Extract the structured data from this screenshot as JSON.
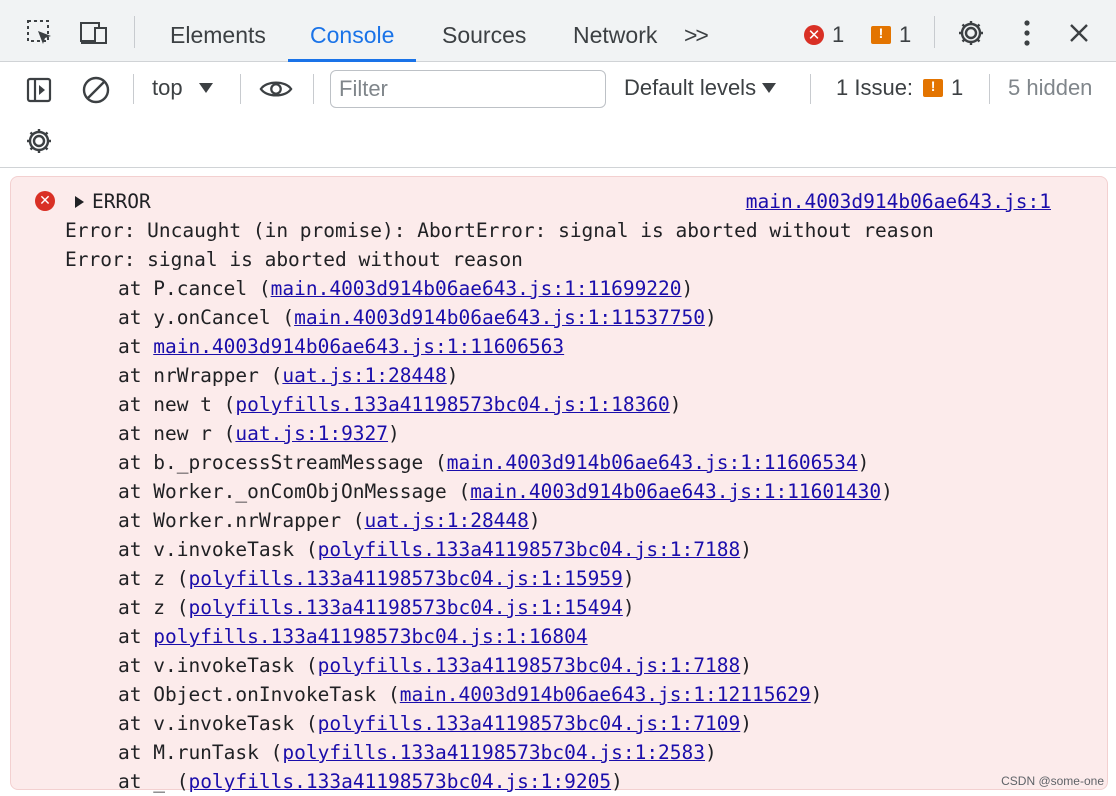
{
  "tabs": [
    {
      "label": "Elements"
    },
    {
      "label": "Console"
    },
    {
      "label": "Sources"
    },
    {
      "label": "Network"
    }
  ],
  "more_tabs": ">>",
  "error_count": "1",
  "warning_count": "1",
  "toolbar": {
    "context": "top",
    "filter_placeholder": "Filter",
    "levels": "Default levels",
    "issues_label": "1 Issue:",
    "issues_count": "1",
    "hidden": "5 hidden"
  },
  "message": {
    "head": "ERROR",
    "source": "main.4003d914b06ae643.js:1",
    "line1": "Error: Uncaught (in promise): AbortError: signal is aborted without reason",
    "line2": "Error: signal is aborted without reason",
    "frames": [
      {
        "prefix": "at P.cancel (",
        "link": "main.4003d914b06ae643.js:1:11699220",
        "suffix": ")"
      },
      {
        "prefix": "at y.onCancel (",
        "link": "main.4003d914b06ae643.js:1:11537750",
        "suffix": ")"
      },
      {
        "prefix": "at ",
        "link": "main.4003d914b06ae643.js:1:11606563",
        "suffix": ""
      },
      {
        "prefix": "at nrWrapper (",
        "link": "uat.js:1:28448",
        "suffix": ")"
      },
      {
        "prefix": "at new t (",
        "link": "polyfills.133a41198573bc04.js:1:18360",
        "suffix": ")"
      },
      {
        "prefix": "at new r (",
        "link": "uat.js:1:9327",
        "suffix": ")"
      },
      {
        "prefix": "at b._processStreamMessage (",
        "link": "main.4003d914b06ae643.js:1:11606534",
        "suffix": ")"
      },
      {
        "prefix": "at Worker._onComObjOnMessage (",
        "link": "main.4003d914b06ae643.js:1:11601430",
        "suffix": ")"
      },
      {
        "prefix": "at Worker.nrWrapper (",
        "link": "uat.js:1:28448",
        "suffix": ")"
      },
      {
        "prefix": "at v.invokeTask (",
        "link": "polyfills.133a41198573bc04.js:1:7188",
        "suffix": ")"
      },
      {
        "prefix": "at z (",
        "link": "polyfills.133a41198573bc04.js:1:15959",
        "suffix": ")"
      },
      {
        "prefix": "at z (",
        "link": "polyfills.133a41198573bc04.js:1:15494",
        "suffix": ")"
      },
      {
        "prefix": "at ",
        "link": "polyfills.133a41198573bc04.js:1:16804",
        "suffix": ""
      },
      {
        "prefix": "at v.invokeTask (",
        "link": "polyfills.133a41198573bc04.js:1:7188",
        "suffix": ")"
      },
      {
        "prefix": "at Object.onInvokeTask (",
        "link": "main.4003d914b06ae643.js:1:12115629",
        "suffix": ")"
      },
      {
        "prefix": "at v.invokeTask (",
        "link": "polyfills.133a41198573bc04.js:1:7109",
        "suffix": ")"
      },
      {
        "prefix": "at M.runTask (",
        "link": "polyfills.133a41198573bc04.js:1:2583",
        "suffix": ")"
      },
      {
        "prefix": "at _ (",
        "link": "polyfills.133a41198573bc04.js:1:9205",
        "suffix": ")"
      }
    ]
  },
  "watermark": "CSDN @some-one",
  "colors": {
    "accent": "#1a73e8",
    "error": "#d93025",
    "warning": "#e37400",
    "error_bg": "#fcebeb",
    "link": "#1a0dab"
  },
  "icons": [
    "inspect-element-icon",
    "device-toolbar-icon",
    "error-icon",
    "warning-icon",
    "settings-gear-icon",
    "more-vertical-icon",
    "close-icon",
    "sidebar-toggle-icon",
    "clear-console-icon",
    "live-expression-eye-icon",
    "console-settings-gear-icon"
  ]
}
